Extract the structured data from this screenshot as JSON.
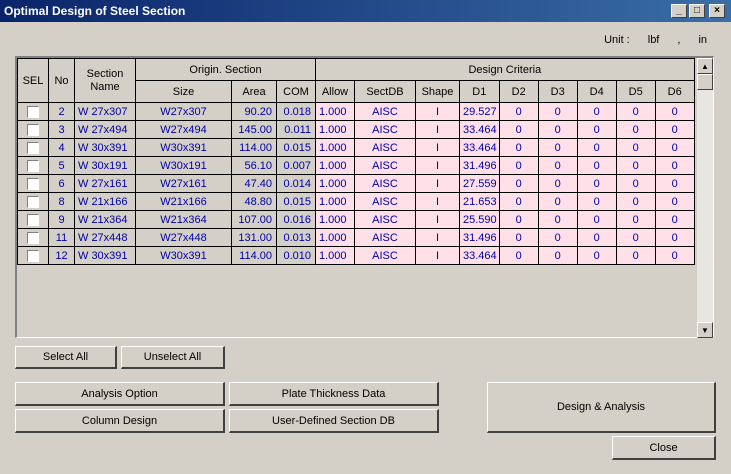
{
  "window": {
    "title": "Optimal Design of Steel Section",
    "minimize": "_",
    "maximize": "□",
    "close": "×"
  },
  "unit": {
    "label": "Unit :",
    "force": "lbf",
    "sep": ",",
    "length": "in"
  },
  "table": {
    "headers": {
      "sel": "SEL",
      "no": "No",
      "section_name": "Section Name",
      "origin_section": "Origin. Section",
      "design_criteria": "Design Criteria",
      "size": "Size",
      "area": "Area",
      "com": "COM",
      "allow": "Allow",
      "sectdb": "SectDB",
      "shape": "Shape",
      "d1": "D1",
      "d2": "D2",
      "d3": "D3",
      "d4": "D4",
      "d5": "D5",
      "d6": "D6"
    },
    "rows": [
      {
        "no": "2",
        "name": "W 27x307",
        "size": "W27x307",
        "area": "90.20",
        "com": "0.018",
        "allow": "1.000",
        "sectdb": "AISC",
        "shape": "I",
        "d1": "29.527",
        "d2": "0",
        "d3": "0",
        "d4": "0",
        "d5": "0",
        "d6": "0"
      },
      {
        "no": "3",
        "name": "W 27x494",
        "size": "W27x494",
        "area": "145.00",
        "com": "0.011",
        "allow": "1.000",
        "sectdb": "AISC",
        "shape": "I",
        "d1": "33.464",
        "d2": "0",
        "d3": "0",
        "d4": "0",
        "d5": "0",
        "d6": "0"
      },
      {
        "no": "4",
        "name": "W 30x391",
        "size": "W30x391",
        "area": "114.00",
        "com": "0.015",
        "allow": "1.000",
        "sectdb": "AISC",
        "shape": "I",
        "d1": "33.464",
        "d2": "0",
        "d3": "0",
        "d4": "0",
        "d5": "0",
        "d6": "0"
      },
      {
        "no": "5",
        "name": "W 30x191",
        "size": "W30x191",
        "area": "56.10",
        "com": "0.007",
        "allow": "1.000",
        "sectdb": "AISC",
        "shape": "I",
        "d1": "31.496",
        "d2": "0",
        "d3": "0",
        "d4": "0",
        "d5": "0",
        "d6": "0"
      },
      {
        "no": "6",
        "name": "W 27x161",
        "size": "W27x161",
        "area": "47.40",
        "com": "0.014",
        "allow": "1.000",
        "sectdb": "AISC",
        "shape": "I",
        "d1": "27.559",
        "d2": "0",
        "d3": "0",
        "d4": "0",
        "d5": "0",
        "d6": "0"
      },
      {
        "no": "8",
        "name": "W 21x166",
        "size": "W21x166",
        "area": "48.80",
        "com": "0.015",
        "allow": "1.000",
        "sectdb": "AISC",
        "shape": "I",
        "d1": "21.653",
        "d2": "0",
        "d3": "0",
        "d4": "0",
        "d5": "0",
        "d6": "0"
      },
      {
        "no": "9",
        "name": "W 21x364",
        "size": "W21x364",
        "area": "107.00",
        "com": "0.016",
        "allow": "1.000",
        "sectdb": "AISC",
        "shape": "I",
        "d1": "25.590",
        "d2": "0",
        "d3": "0",
        "d4": "0",
        "d5": "0",
        "d6": "0"
      },
      {
        "no": "11",
        "name": "W 27x448",
        "size": "W27x448",
        "area": "131.00",
        "com": "0.013",
        "allow": "1.000",
        "sectdb": "AISC",
        "shape": "I",
        "d1": "31.496",
        "d2": "0",
        "d3": "0",
        "d4": "0",
        "d5": "0",
        "d6": "0"
      },
      {
        "no": "12",
        "name": "W 30x391",
        "size": "W30x391",
        "area": "114.00",
        "com": "0.010",
        "allow": "1.000",
        "sectdb": "AISC",
        "shape": "I",
        "d1": "33.464",
        "d2": "0",
        "d3": "0",
        "d4": "0",
        "d5": "0",
        "d6": "0"
      }
    ]
  },
  "buttons": {
    "select_all": "Select All",
    "unselect_all": "Unselect All",
    "analysis_option": "Analysis Option",
    "plate_thickness": "Plate Thickness Data",
    "column_design": "Column Design",
    "user_defined_db": "User-Defined Section DB",
    "design_analysis": "Design & Analysis",
    "close": "Close"
  },
  "colors": {
    "title_bar": "#0a246a",
    "value_text": "#0000a0",
    "design_cell_bg": "#ffe0e8",
    "window_bg": "#d4d0c8"
  }
}
